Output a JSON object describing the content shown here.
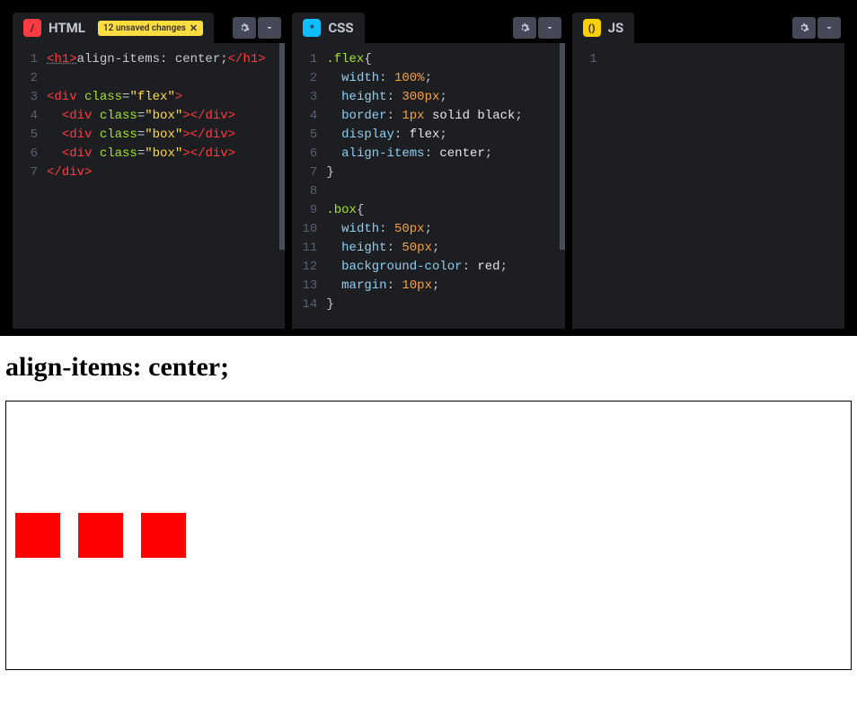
{
  "panels": {
    "html": {
      "title": "HTML",
      "badge": "/",
      "unsaved": "12 unsaved changes",
      "lines": [
        "1",
        "2",
        "3",
        "4",
        "5",
        "6",
        "7"
      ]
    },
    "css": {
      "title": "CSS",
      "badge": "*",
      "lines": [
        "1",
        "2",
        "3",
        "4",
        "5",
        "6",
        "7",
        "8",
        "9",
        "10",
        "11",
        "12",
        "13",
        "14"
      ]
    },
    "js": {
      "title": "JS",
      "badge": "()",
      "lines": [
        "1"
      ]
    }
  },
  "html_code": {
    "l1_tag_open": "<h1>",
    "l1_text": "align-items: center;",
    "l1_tag_close": "</h1>",
    "l3_tag": "<div",
    "class_attr": "class",
    "flex_val": "\"flex\"",
    "box_val": "\"box\"",
    "close_angle": ">",
    "div_close": "</div>",
    "div_open_attr_line": "  <div "
  },
  "css_code": {
    "sel_flex": ".flex",
    "brace_open": "{",
    "brace_close": "}",
    "p_width": "width",
    "v_100pct": "100%",
    "p_height": "height",
    "v_300px": "300px",
    "p_border": "border",
    "v_1px": "1px",
    "v_solid_black": " solid black",
    "p_display": "display",
    "v_flex": "flex",
    "p_align": "align-items",
    "v_center": "center",
    "sel_box": ".box",
    "v_50px": "50px",
    "p_bg": "background-color",
    "v_red": "red",
    "p_margin": "margin",
    "v_10px": "10px",
    "colon": ": ",
    "semi": ";"
  },
  "result": {
    "heading": "align-items: center;"
  }
}
